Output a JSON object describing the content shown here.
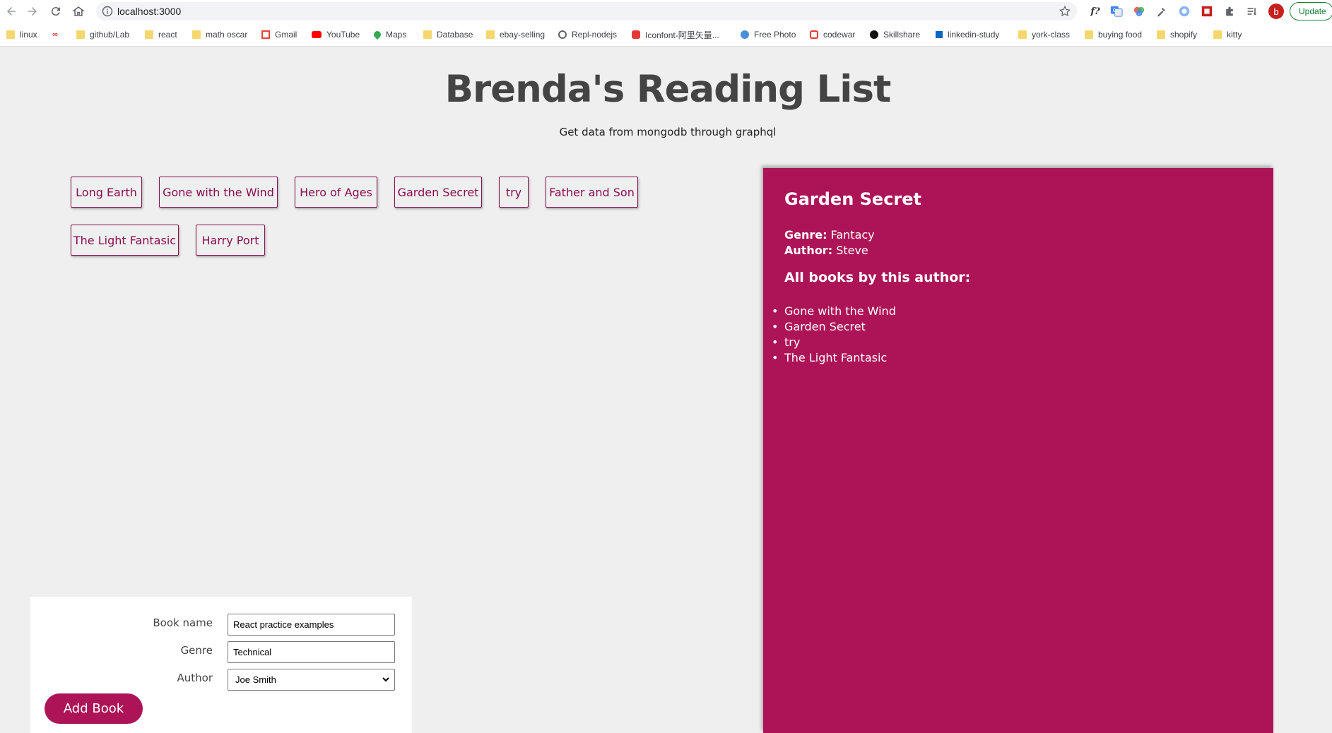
{
  "browser": {
    "url": "localhost:3000",
    "update_label": "Update",
    "profile_initial": "b",
    "extension_f_label": "f?",
    "bookmarks": [
      {
        "label": "linux",
        "icon": "folder-icon"
      },
      {
        "label": "",
        "icon": "app-icon"
      },
      {
        "label": "github/Lab",
        "icon": "folder-icon"
      },
      {
        "label": "react",
        "icon": "folder-icon"
      },
      {
        "label": "math oscar",
        "icon": "folder-icon"
      },
      {
        "label": "Gmail",
        "icon": "gmail-icon"
      },
      {
        "label": "YouTube",
        "icon": "youtube-icon"
      },
      {
        "label": "Maps",
        "icon": "maps-icon"
      },
      {
        "label": "Database",
        "icon": "folder-icon"
      },
      {
        "label": "ebay-selling",
        "icon": "folder-icon"
      },
      {
        "label": "Repl-nodejs",
        "icon": "repl-icon"
      },
      {
        "label": "Iconfont-阿里矢量...",
        "icon": "iconfont-icon"
      },
      {
        "label": "Free Photo",
        "icon": "photo-icon"
      },
      {
        "label": "codewar",
        "icon": "codewars-icon"
      },
      {
        "label": "Skillshare",
        "icon": "skillshare-icon"
      },
      {
        "label": "linkedin-study",
        "icon": "linkedin-icon"
      },
      {
        "label": "york-class",
        "icon": "folder-icon"
      },
      {
        "label": "buying food",
        "icon": "folder-icon"
      },
      {
        "label": "shopify",
        "icon": "folder-icon"
      },
      {
        "label": "kitty",
        "icon": "folder-icon"
      }
    ]
  },
  "header": {
    "title": "Brenda's Reading List",
    "subtitle": "Get data from mongodb through graphql"
  },
  "books": [
    "Long Earth",
    "Gone with the Wind",
    "Hero of Ages",
    "Garden Secret",
    "try",
    "Father and Son",
    "The Light Fantasic",
    "Harry Port"
  ],
  "details": {
    "title": "Garden Secret",
    "genre_label": "Genre:",
    "genre": "Fantacy",
    "author_label": "Author:",
    "author": "Steve",
    "all_books_heading": "All books by this author:",
    "author_books": [
      "Gone with the Wind",
      "Garden Secret",
      "try",
      "The Light Fantasic"
    ]
  },
  "form": {
    "book_name_label": "Book name",
    "book_name_value": "React practice examples",
    "genre_label": "Genre",
    "genre_value": "Technical",
    "author_label": "Author",
    "author_value": "Joe Smith",
    "submit_label": "Add Book"
  },
  "colors": {
    "accent": "#ad1457",
    "book_border": "#880e4f",
    "background": "#efefef"
  }
}
